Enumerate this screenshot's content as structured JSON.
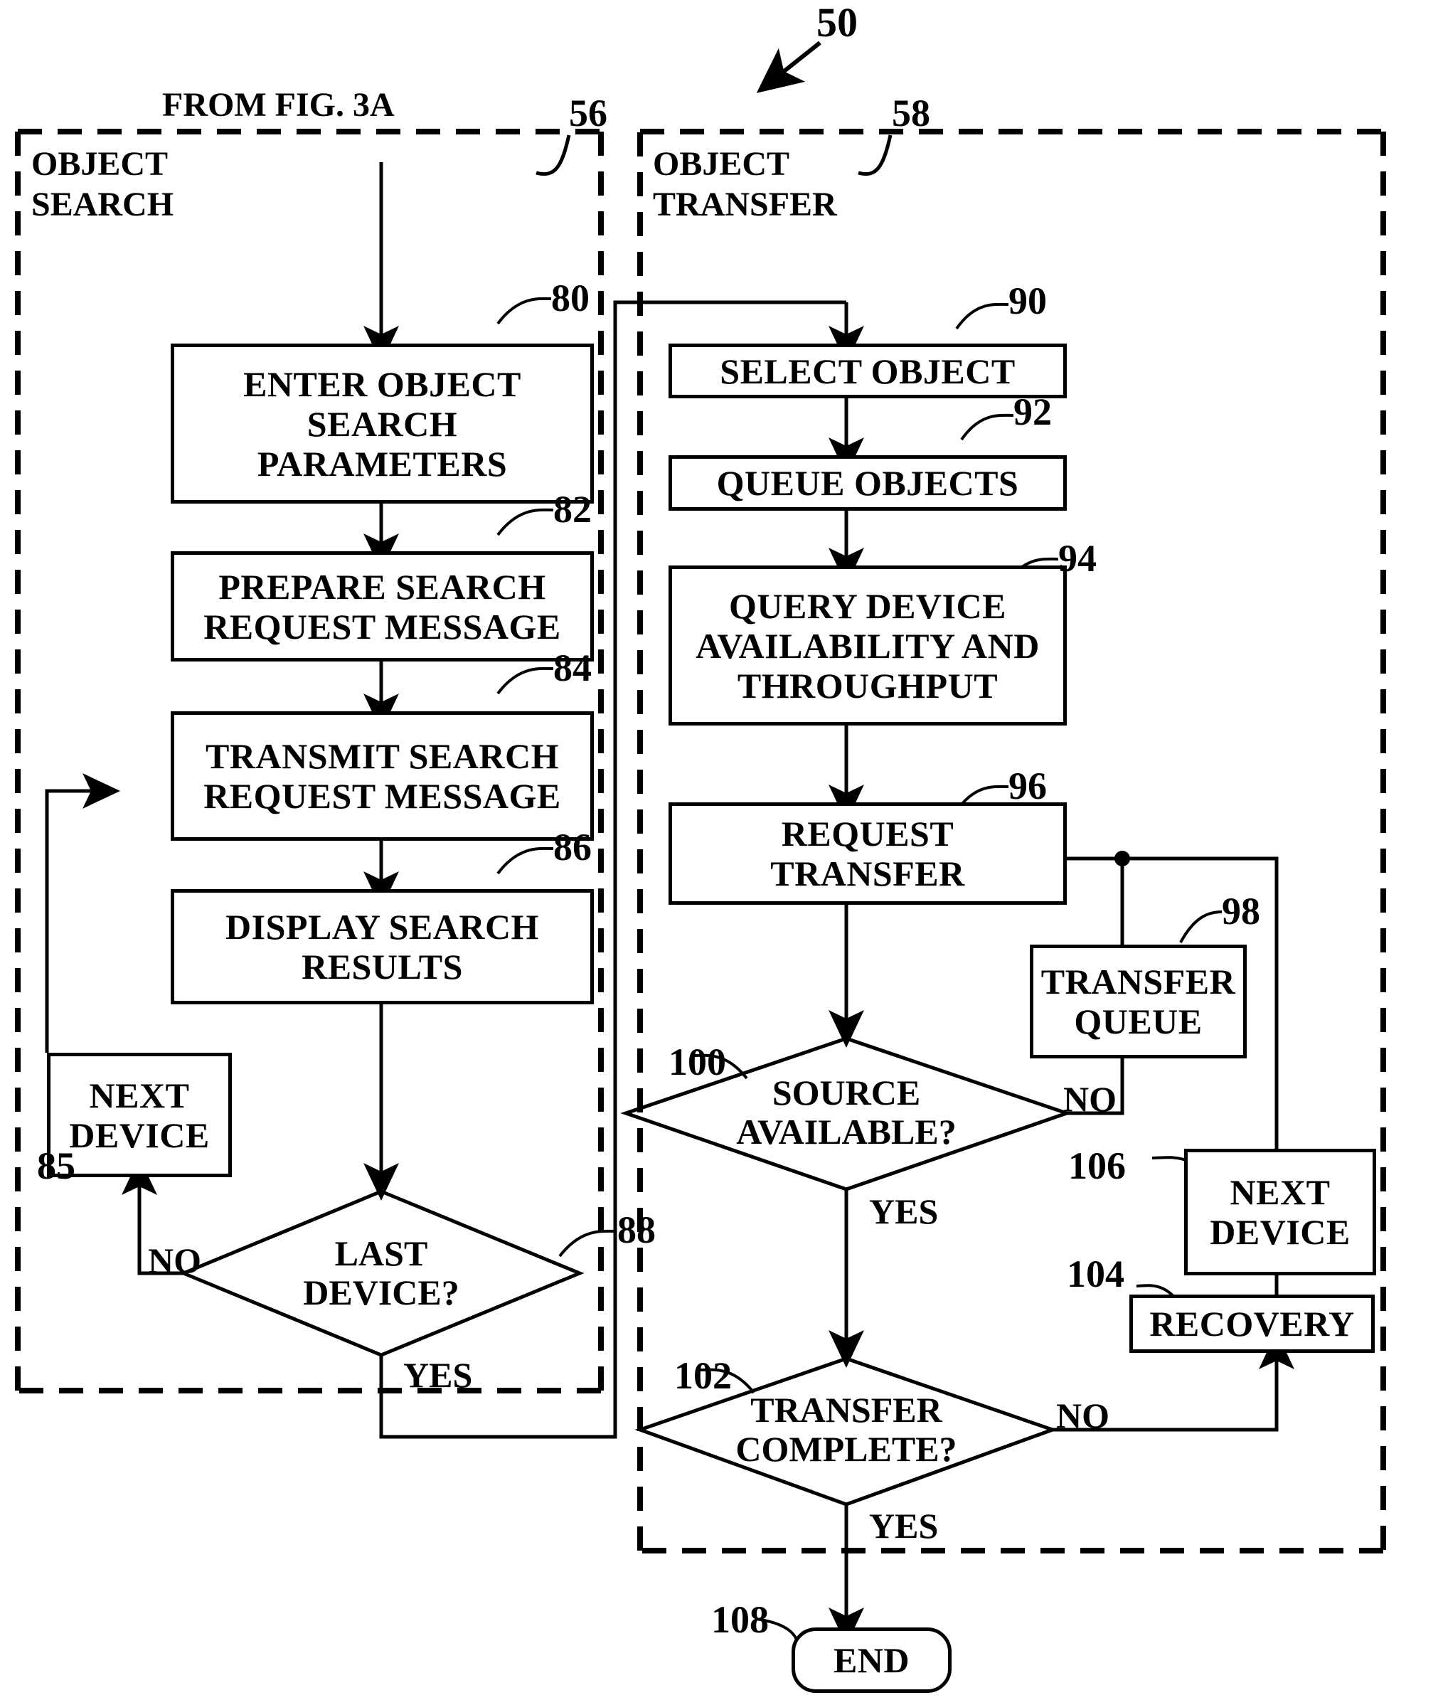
{
  "figure": {
    "label": "50",
    "from_note": "FROM FIG. 3A"
  },
  "panels": [
    {
      "id": "object-search",
      "title": "OBJECT\nSEARCH",
      "ref": "56"
    },
    {
      "id": "object-transfer",
      "title": "OBJECT\nTRANSFER",
      "ref": "58"
    }
  ],
  "nodes": {
    "enter_params": {
      "label": "ENTER OBJECT\nSEARCH\nPARAMETERS",
      "ref": "80",
      "shape": "process"
    },
    "prepare_msg": {
      "label": "PREPARE SEARCH\nREQUEST MESSAGE",
      "ref": "82",
      "shape": "process"
    },
    "transmit_msg": {
      "label": "TRANSMIT SEARCH\nREQUEST MESSAGE",
      "ref": "84",
      "shape": "process"
    },
    "display_results": {
      "label": "DISPLAY SEARCH\nRESULTS",
      "ref": "86",
      "shape": "process"
    },
    "next_device_left": {
      "label": "NEXT\nDEVICE",
      "ref": "85",
      "shape": "process"
    },
    "last_device": {
      "label": "LAST\nDEVICE?",
      "ref": "88",
      "shape": "decision"
    },
    "select_object": {
      "label": "SELECT OBJECT",
      "ref": "90",
      "shape": "process"
    },
    "queue_objects": {
      "label": "QUEUE OBJECTS",
      "ref": "92",
      "shape": "process"
    },
    "query_device": {
      "label": "QUERY DEVICE\nAVAILABILITY AND\nTHROUGHPUT",
      "ref": "94",
      "shape": "process"
    },
    "request_transfer": {
      "label": "REQUEST\nTRANSFER",
      "ref": "96",
      "shape": "process"
    },
    "transfer_queue": {
      "label": "TRANSFER\nQUEUE",
      "ref": "98",
      "shape": "process"
    },
    "source_available": {
      "label": "SOURCE\nAVAILABLE?",
      "ref": "100",
      "shape": "decision"
    },
    "transfer_complete": {
      "label": "TRANSFER\nCOMPLETE?",
      "ref": "102",
      "shape": "decision"
    },
    "recovery": {
      "label": "RECOVERY",
      "ref": "104",
      "shape": "process"
    },
    "next_device_right": {
      "label": "NEXT\nDEVICE",
      "ref": "106",
      "shape": "process"
    },
    "end": {
      "label": "END",
      "ref": "108",
      "shape": "terminator"
    }
  },
  "edge_labels": {
    "last_device_no": "NO",
    "last_device_yes": "YES",
    "source_available_no": "NO",
    "source_available_yes": "YES",
    "transfer_complete_no": "NO",
    "transfer_complete_yes": "YES"
  },
  "colors": {
    "ink": "#000000",
    "paper": "#ffffff"
  }
}
